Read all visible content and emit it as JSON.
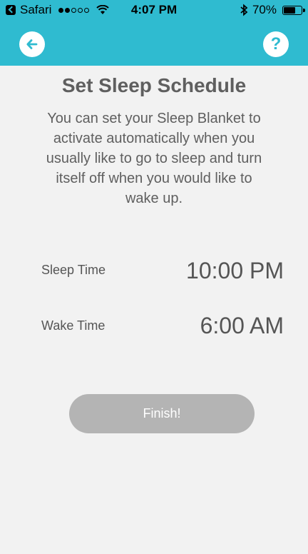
{
  "status_bar": {
    "app_back_label": "Safari",
    "time": "4:07 PM",
    "battery_text": "70%",
    "battery_level": 0.7
  },
  "nav": {
    "back_icon": "arrow-left-icon",
    "help_label": "?"
  },
  "content": {
    "title": "Set Sleep Schedule",
    "description": "You can set your Sleep Blanket to activate automatically when you usually like to go to sleep and turn itself off when you would like to wake up.",
    "sleep_label": "Sleep Time",
    "sleep_value": "10:00 PM",
    "wake_label": "Wake Time",
    "wake_value": "6:00 AM",
    "finish_label": "Finish!"
  },
  "colors": {
    "header": "#2fbbd0",
    "background": "#f2f2f2",
    "button_disabled": "#b4b4b4",
    "text": "#5f5f5f"
  }
}
